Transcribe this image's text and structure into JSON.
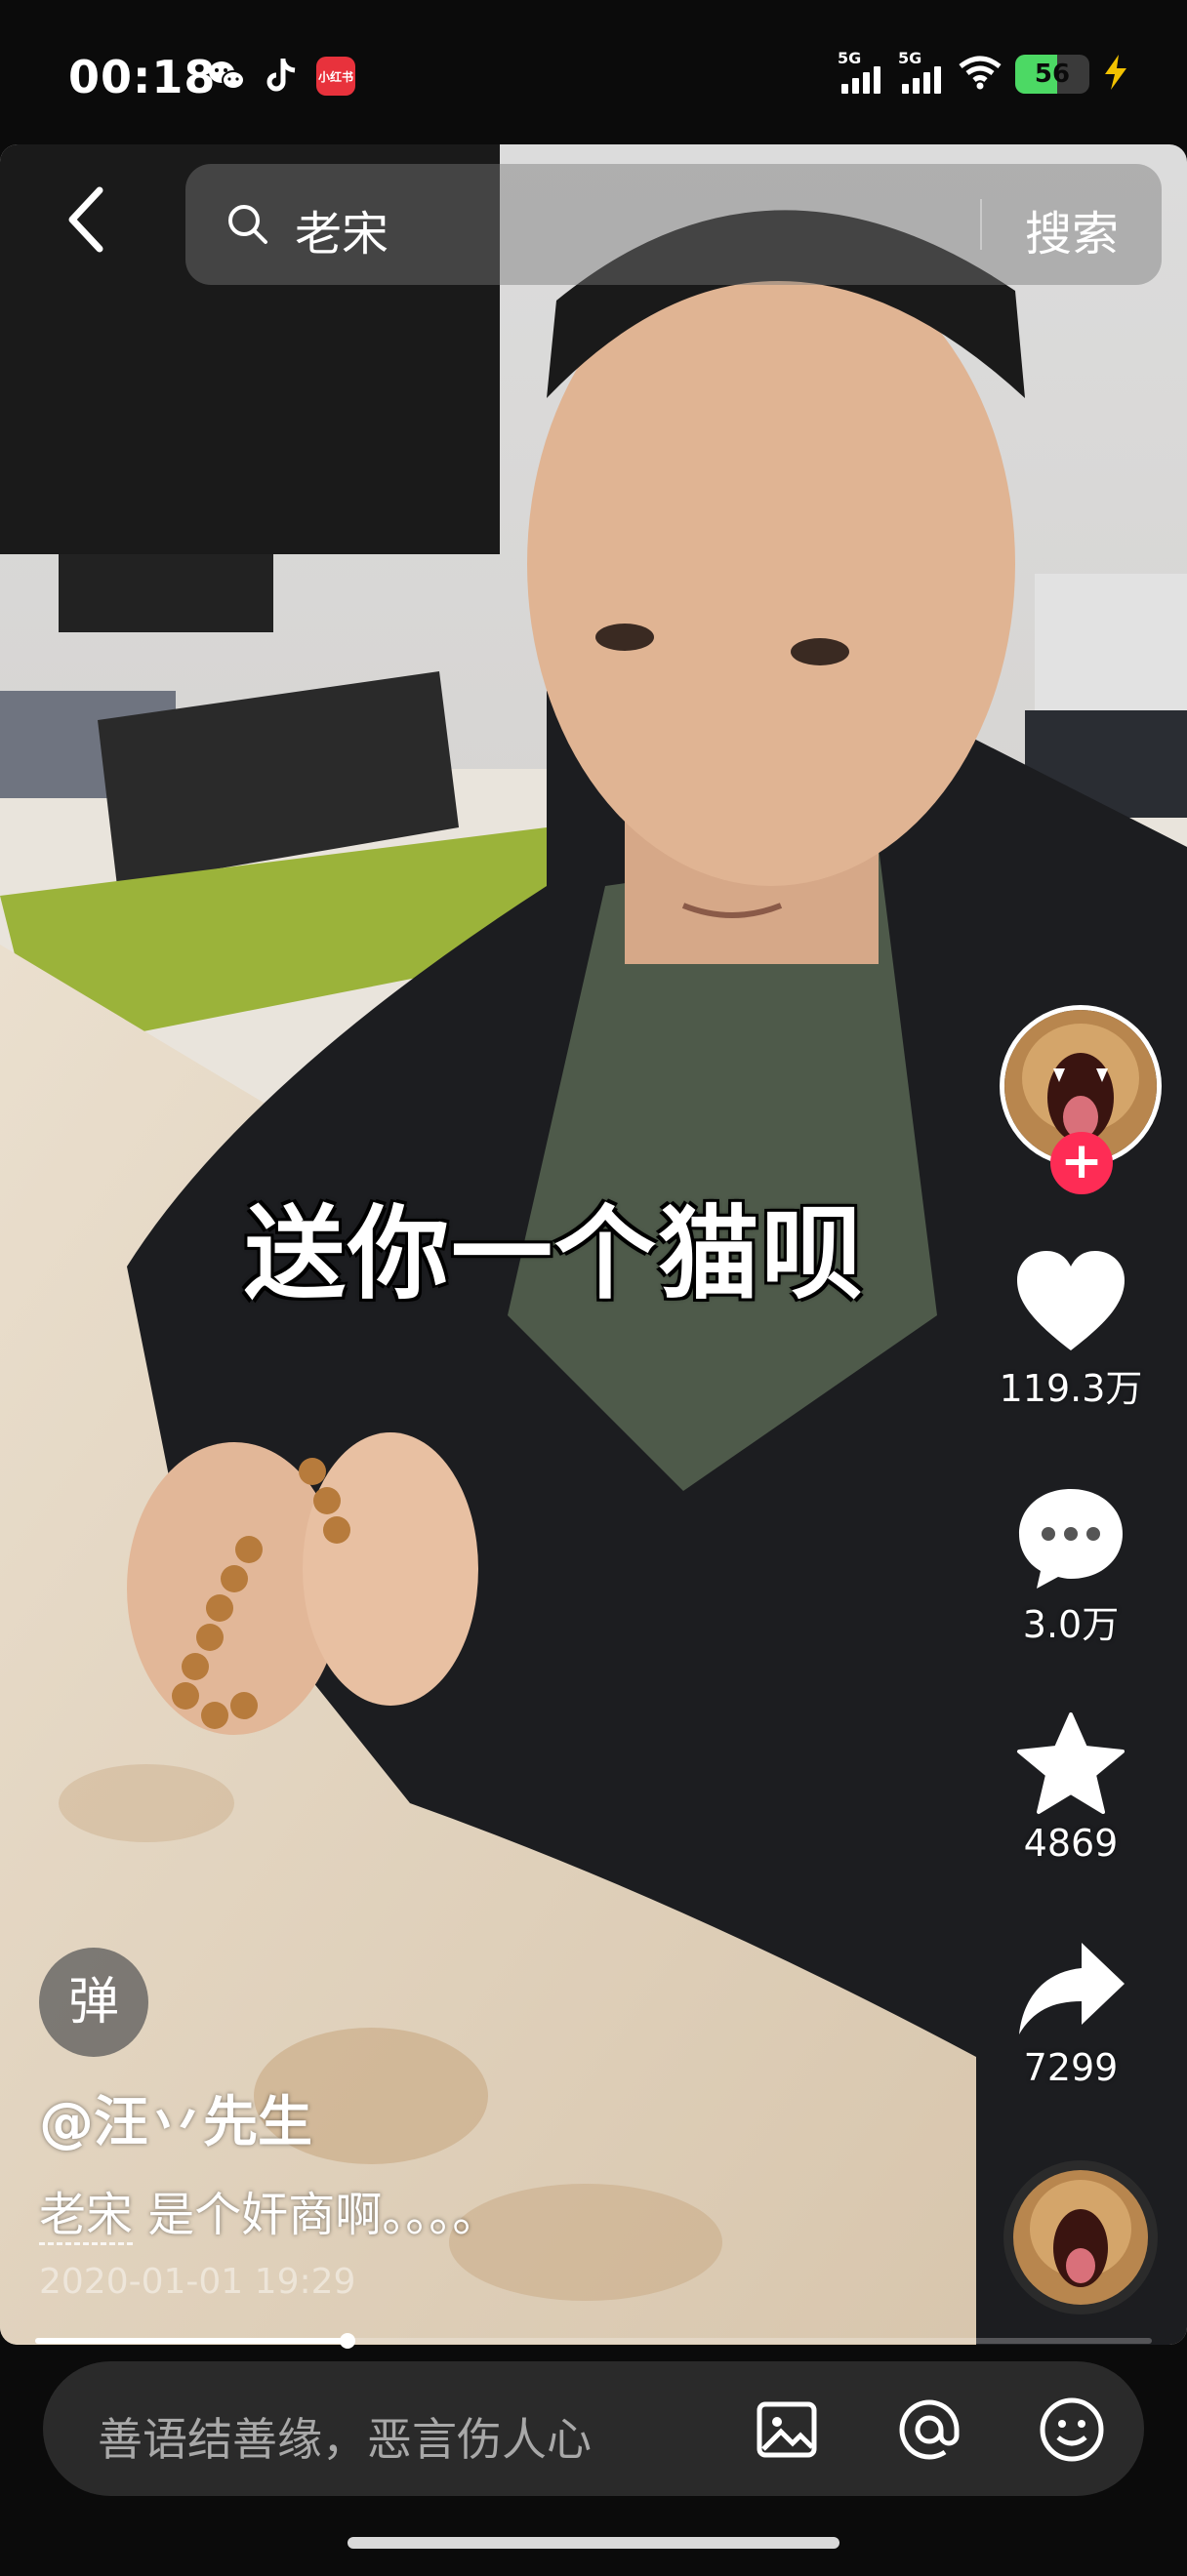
{
  "status_bar": {
    "time": "00:18",
    "app_badge_label": "小红书",
    "network_1": "5G",
    "network_2": "5G",
    "battery_level": "56",
    "battery_fraction": 0.56
  },
  "search": {
    "query": "老宋",
    "button_label": "搜索"
  },
  "video": {
    "caption": "送你一个猫呗",
    "progress_fraction": 0.28
  },
  "actions": {
    "likes": "119.3万",
    "comments": "3.0万",
    "favorites": "4869",
    "shares": "7299"
  },
  "follow_plus": "+",
  "danmu_label": "弹",
  "post": {
    "author": "@汪丷先生",
    "desc_tag": "老宋",
    "desc_text": " 是个奸商啊。。。。",
    "time": "2020-01-01 19:29"
  },
  "comment_bar": {
    "placeholder": "善语结善缘，恶言伤人心"
  },
  "colors": {
    "accent_red": "#fe2c55",
    "battery_green": "#4cd964",
    "comment_bg": "#2a2a2a"
  },
  "icons": [
    "wechat-icon",
    "tiktok-icon",
    "xiaohongshu-icon",
    "wifi-icon",
    "charging-icon",
    "back-icon",
    "search-icon",
    "heart-icon",
    "comment-icon",
    "star-icon",
    "share-icon",
    "image-icon",
    "at-icon",
    "emoji-icon"
  ]
}
